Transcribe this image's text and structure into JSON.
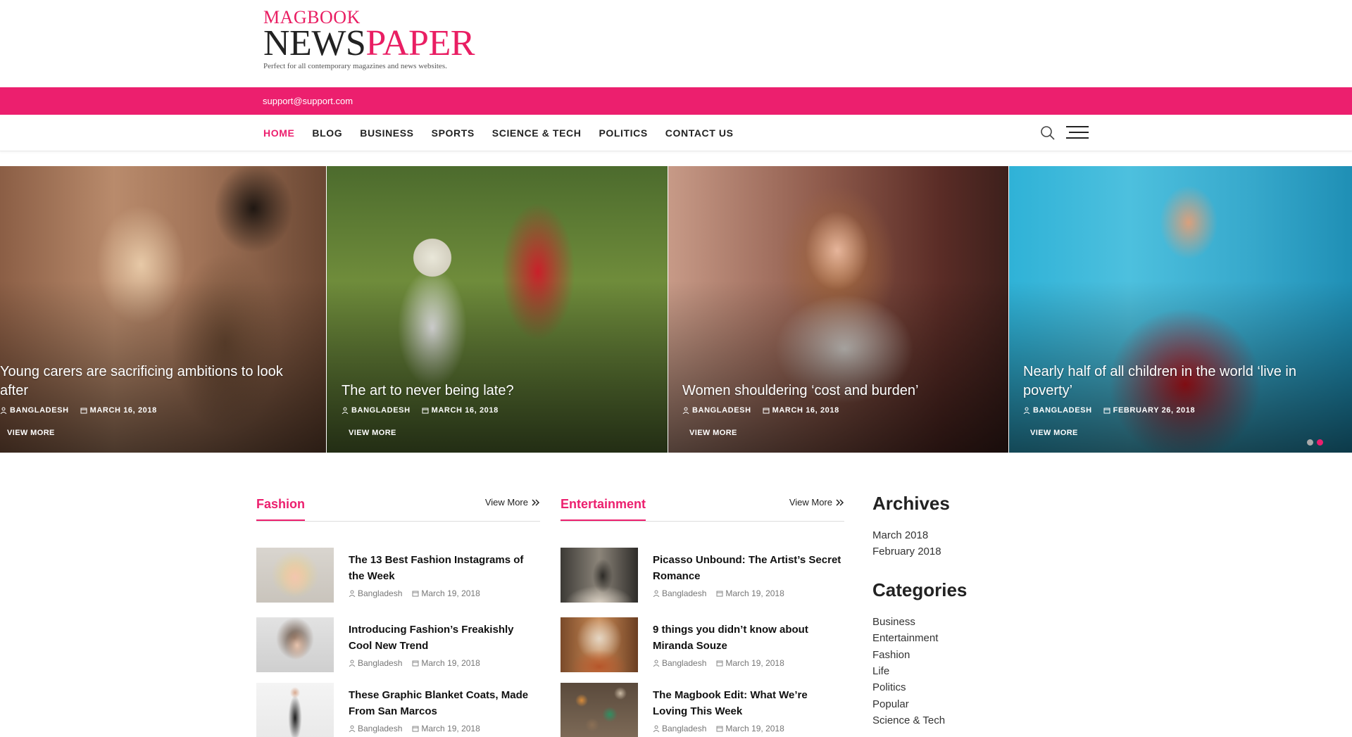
{
  "logo": {
    "line1": "MAGBOOK",
    "line2a": "NEWS",
    "line2b": "PAPER",
    "tagline": "Perfect for all contemporary magazines and news websites."
  },
  "topbar": {
    "email": "support@support.com"
  },
  "nav": {
    "items": [
      "HOME",
      "BLOG",
      "BUSINESS",
      "SPORTS",
      "SCIENCE & TECH",
      "POLITICS",
      "CONTACT US"
    ],
    "active_index": 0
  },
  "slider": {
    "slides": [
      {
        "title": "Young carers are sacrificing ambitions to look after",
        "author": "BANGLADESH",
        "date": "MARCH 16, 2018",
        "cta": "VIEW MORE"
      },
      {
        "title": "The art to never being late?",
        "author": "BANGLADESH",
        "date": "MARCH 16, 2018",
        "cta": "VIEW MORE"
      },
      {
        "title": "Women shouldering ‘cost and burden’",
        "author": "BANGLADESH",
        "date": "MARCH 16, 2018",
        "cta": "VIEW MORE"
      },
      {
        "title": "Nearly half of all children in the world ‘live in poverty’",
        "author": "BANGLADESH",
        "date": "FEBRUARY 26, 2018",
        "cta": "VIEW MORE"
      }
    ],
    "dots": 2,
    "active_dot": 1
  },
  "fashion": {
    "heading": "Fashion",
    "view_more": "View More",
    "posts": [
      {
        "title": "The 13 Best Fashion Instagrams of the Week",
        "author": "Bangladesh",
        "date": "March 19, 2018"
      },
      {
        "title": "Introducing Fashion’s Freakishly Cool New Trend",
        "author": "Bangladesh",
        "date": "March 19, 2018"
      },
      {
        "title": "These Graphic Blanket Coats, Made From San Marcos",
        "author": "Bangladesh",
        "date": "March 19, 2018"
      }
    ]
  },
  "entertainment": {
    "heading": "Entertainment",
    "view_more": "View More",
    "posts": [
      {
        "title": "Picasso Unbound: The Artist’s Secret Romance",
        "author": "Bangladesh",
        "date": "March 19, 2018"
      },
      {
        "title": "9 things you didn’t know about Miranda Souze",
        "author": "Bangladesh",
        "date": "March 19, 2018"
      },
      {
        "title": "The Magbook Edit: What We’re Loving This Week",
        "author": "Bangladesh",
        "date": "March 19, 2018"
      }
    ]
  },
  "sidebar": {
    "archives_title": "Archives",
    "archives": [
      "March 2018",
      "February 2018"
    ],
    "categories_title": "Categories",
    "categories": [
      "Business",
      "Entertainment",
      "Fashion",
      "Life",
      "Politics",
      "Popular",
      "Science & Tech"
    ]
  },
  "colors": {
    "accent": "#ec1f6e",
    "text": "#222222"
  }
}
